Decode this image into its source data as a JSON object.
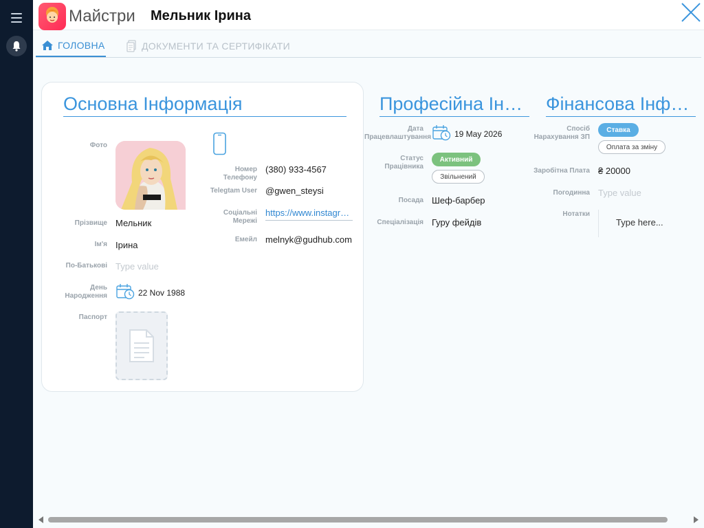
{
  "app": {
    "name": "Майстри",
    "record_title": "Мельник Ірина"
  },
  "tabs": [
    {
      "label": "ГОЛОВНА",
      "active": true
    },
    {
      "label": "ДОКУМЕНТИ ТА СЕРТИФІКАТИ",
      "active": false
    }
  ],
  "basic": {
    "title": "Основна Інформація",
    "photo_label": "Фото",
    "surname_label": "Прізвище",
    "surname": "Мельник",
    "name_label": "Ім'я",
    "name": "Ірина",
    "patronymic_label": "По-Батькові",
    "patronymic_placeholder": "Type value",
    "birthday_label": "День Народження",
    "birthday": "22 Nov 1988",
    "passport_label": "Паспорт",
    "phone_label": "Номер Телефону",
    "phone": "(380) 933-4567",
    "telegram_label": "Telegtam User",
    "telegram": "@gwen_steysi",
    "social_label": "Соціальні Мережі",
    "social": "https://www.instagram.com/",
    "email_label": "Емейл",
    "email": "melnyk@gudhub.com"
  },
  "professional": {
    "title": "Професійна Інформація",
    "hire_label": "Дата Працевлаштування",
    "hire_date": "19 May 2026",
    "status_label": "Статус Працівника",
    "status_active": "Активний",
    "status_fired": "Звільнений",
    "position_label": "Посада",
    "position": "Шеф-барбер",
    "spec_label": "Спеціалізація",
    "spec": "Гуру фейдів"
  },
  "financial": {
    "title": "Фінансова Інформація",
    "method_label": "Спосіб Нарахування ЗП",
    "method_rate": "Ставка",
    "method_shift": "Оплата за зміну",
    "salary_label": "Заробітна Плата",
    "salary": "₴ 20000",
    "hourly_label": "Погодинна",
    "hourly_placeholder": "Type value",
    "notes_label": "Нотатки",
    "notes_placeholder": "Type here..."
  },
  "colors": {
    "accent": "#3b95dd",
    "sidebar": "#0d1b2e",
    "status_green": "#7cc27e",
    "rate_blue": "#5aaee4"
  }
}
